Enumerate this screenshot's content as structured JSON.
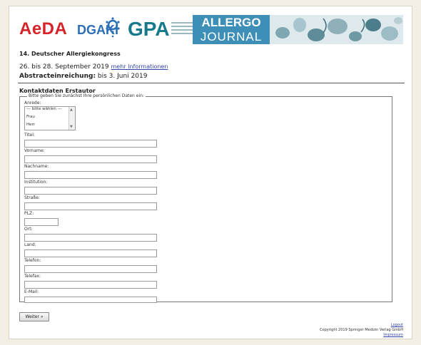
{
  "banner": {
    "aeda": "AeDA",
    "dgaki": "DGAKI",
    "gpa": "GPA",
    "allergo_top": "ALLERGO",
    "allergo_bottom": "JOURNAL"
  },
  "congress": {
    "title": "14. Deutscher Allergiekongress",
    "dates": "26. bis 28. September 2019",
    "more_link": "mehr Informationen",
    "abstract_label": "Abstracteinreichung:",
    "abstract_deadline": "bis 3. Juni 2019"
  },
  "section_title": "Kontaktdaten Erstautor",
  "form": {
    "legend": "Bitte geben Sie zunächst Ihre persönlichen Daten ein:",
    "anrede_label": "Anrede:",
    "anrede_options": [
      "--- bitte wählen ---",
      "Frau",
      "Herr"
    ],
    "fields": {
      "titel": "Titel:",
      "vorname": "Vorname:",
      "nachname": "Nachname:",
      "institution": "Institution:",
      "strasse": "Straße:",
      "plz": "PLZ:",
      "ort": "Ort:",
      "land": "Land:",
      "telefon": "Telefon:",
      "telefax": "Telefax:",
      "email": "E-Mail:"
    },
    "submit": "Weiter »"
  },
  "footer": {
    "logout": "Logout",
    "copyright": "Copyright 2019 Springer Medizin Verlag GmbH",
    "impressum": "Impressum"
  },
  "colors": {
    "aeda_red": "#d6232a",
    "dgaki_blue": "#2c6fb6",
    "gpa_teal": "#177a8a",
    "allergo_blue": "#3d8fb8",
    "link": "#3344aa"
  }
}
